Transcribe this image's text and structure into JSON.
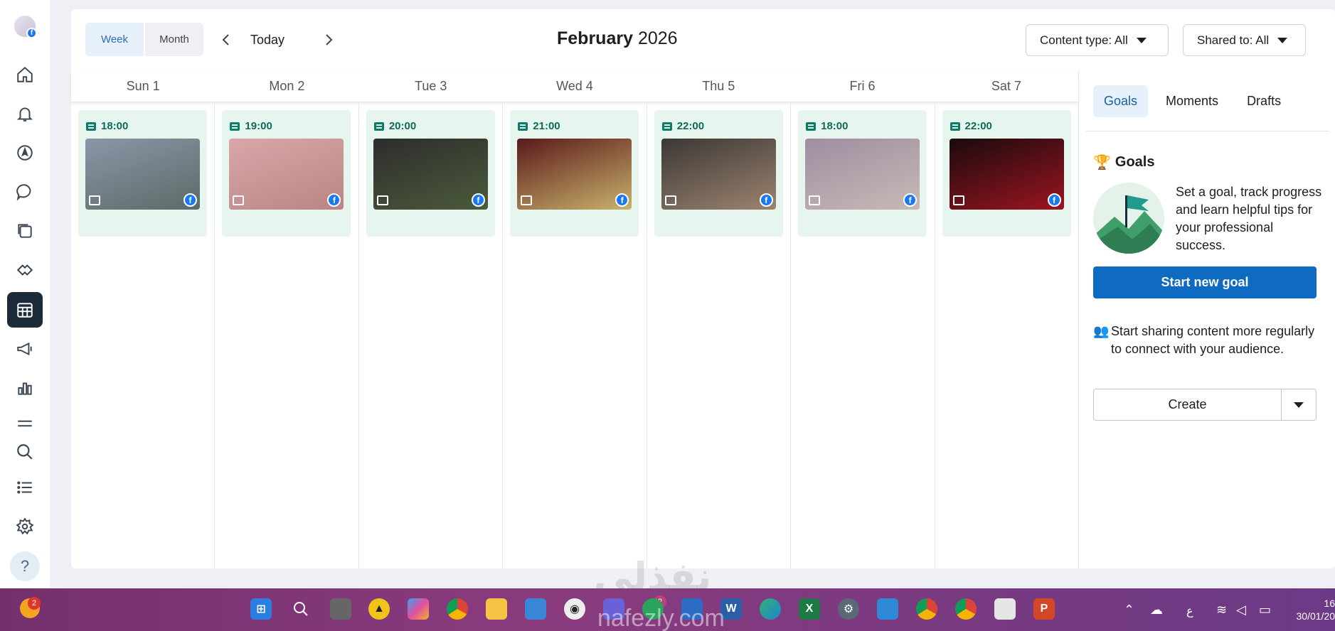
{
  "calendar": {
    "view_week": "Week",
    "view_month": "Month",
    "today": "Today",
    "month": "February",
    "year": "2026",
    "filter_content": "Content type: All",
    "filter_shared": "Shared to: All",
    "days": [
      "Sun 1",
      "Mon 2",
      "Tue 3",
      "Wed 4",
      "Thu 5",
      "Fri 6",
      "Sat 7"
    ],
    "posts": [
      {
        "time": "18:00",
        "colors": [
          "#8c95a7",
          "#5b6b68"
        ]
      },
      {
        "time": "19:00",
        "colors": [
          "#d9a7a8",
          "#b98584"
        ]
      },
      {
        "time": "20:00",
        "colors": [
          "#2d2d2c",
          "#4c5a3b"
        ]
      },
      {
        "time": "21:00",
        "colors": [
          "#5a1a1b",
          "#c9b26b"
        ]
      },
      {
        "time": "22:00",
        "colors": [
          "#3b3835",
          "#9c8370"
        ]
      },
      {
        "time": "18:00",
        "colors": [
          "#9e8ea1",
          "#c8b9b6"
        ]
      },
      {
        "time": "22:00",
        "colors": [
          "#1a0a0d",
          "#9c1520"
        ]
      }
    ]
  },
  "panel": {
    "tabs": [
      "Goals",
      "Moments",
      "Drafts"
    ],
    "goals_title": "Goals",
    "goal_text": "Set a goal, track progress and learn helpful tips for your professional success.",
    "start_goal": "Start new goal",
    "share_text": "Start sharing content more regularly to connect with your audience.",
    "create": "Create"
  },
  "watermark": {
    "arabic": "نفذلي",
    "latin": "nafezly.com"
  },
  "taskbar": {
    "weather_badge": "2",
    "teams_badge": "2",
    "lang": "ع",
    "clock_time": "16",
    "clock_date": "30/01/20"
  },
  "colors": {
    "accent": "#0f6ac2",
    "post_bg": "#e6f5ee",
    "active_rail": "#1c2b3a",
    "facebook": "#1877f2"
  }
}
